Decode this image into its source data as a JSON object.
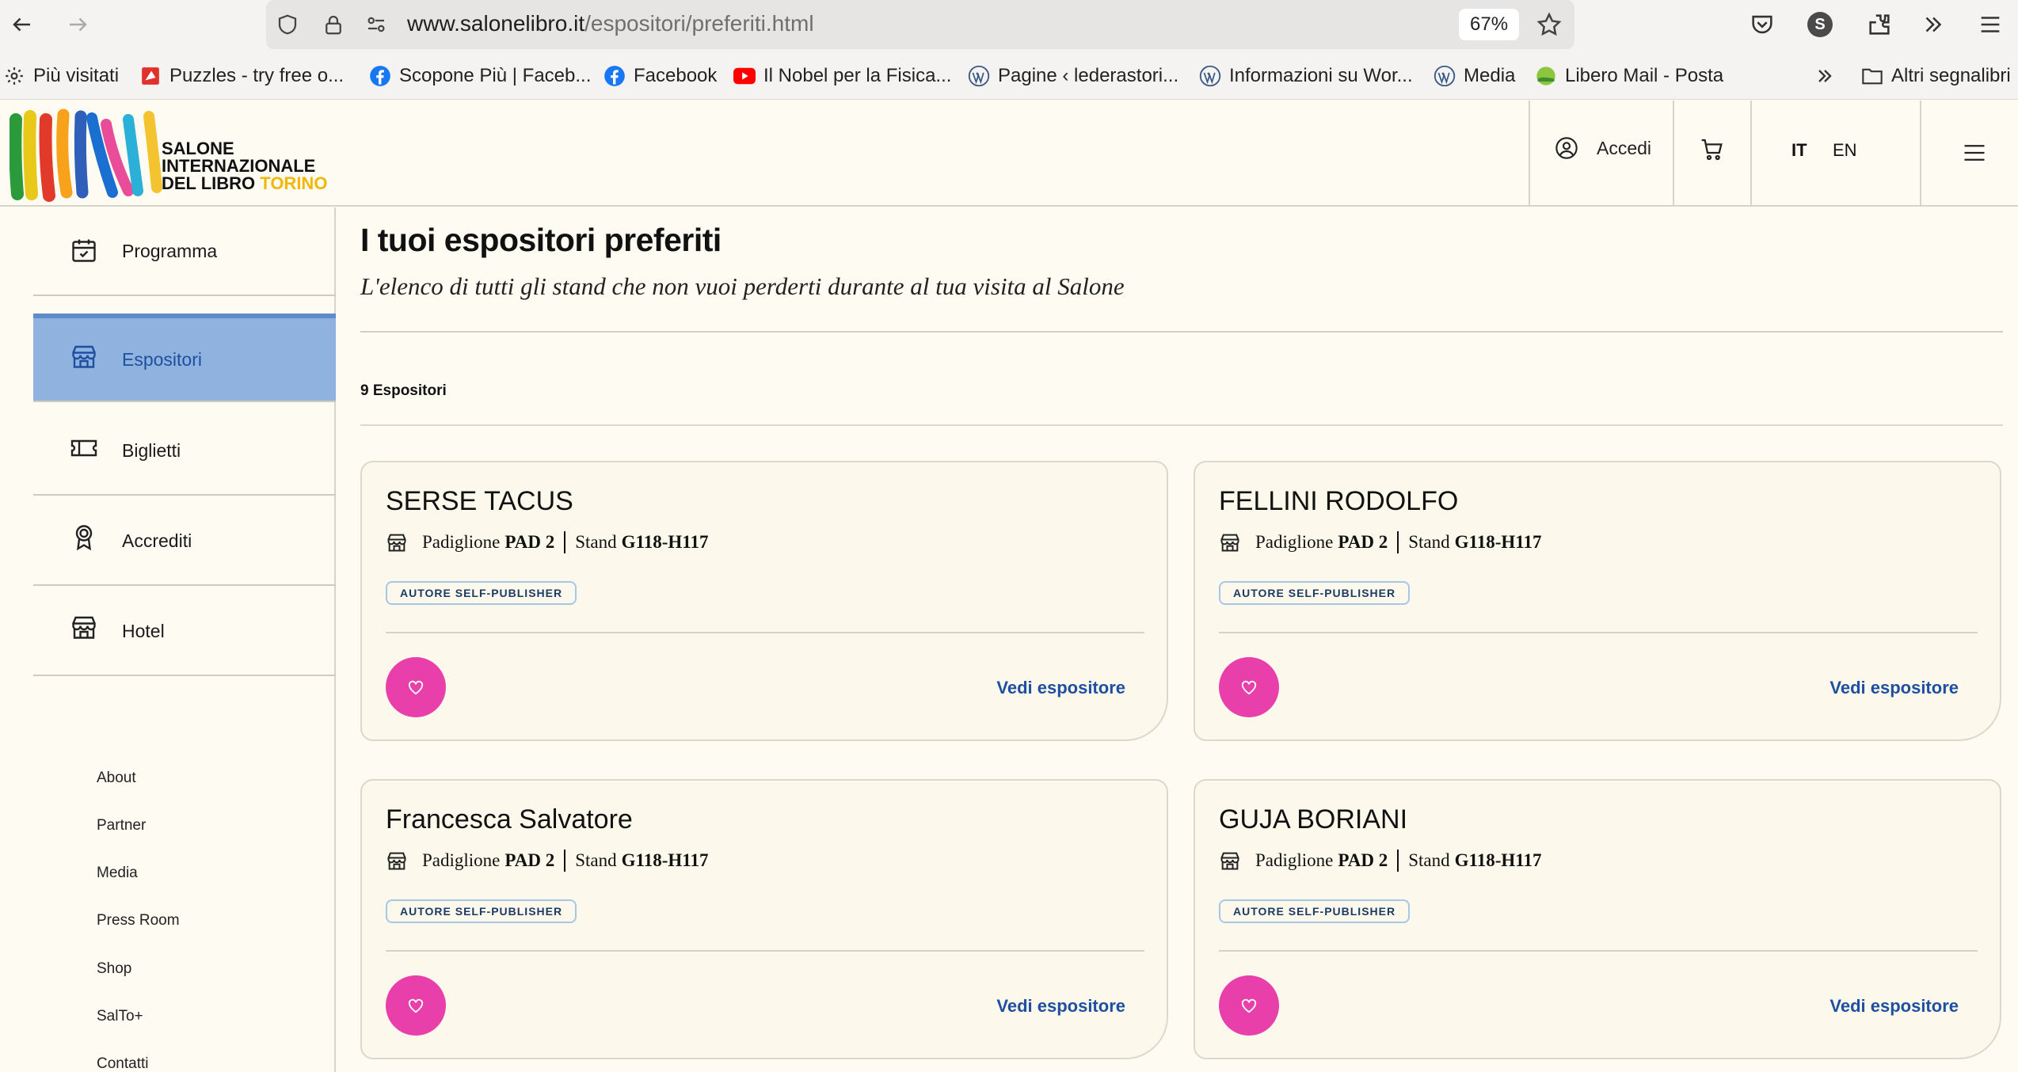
{
  "browser": {
    "url_host": "www.salonelibro.it",
    "url_path": "/espositori/preferiti.html",
    "zoom": "67%",
    "profile_initial": "S",
    "bookmarks": [
      {
        "label": "Più visitati",
        "icon": "gear-icon"
      },
      {
        "label": "Puzzles - try free o...",
        "icon": "puzzle-icon"
      },
      {
        "label": "Scopone Più | Faceb...",
        "icon": "facebook-icon"
      },
      {
        "label": "Facebook",
        "icon": "facebook-icon"
      },
      {
        "label": "Il Nobel per la Fisica...",
        "icon": "youtube-icon"
      },
      {
        "label": "Pagine ‹ lederastori...",
        "icon": "wordpress-icon"
      },
      {
        "label": "Informazioni su Wor...",
        "icon": "wordpress-icon"
      },
      {
        "label": "Media",
        "icon": "wordpress-icon"
      },
      {
        "label": "Libero Mail - Posta",
        "icon": "libero-icon"
      }
    ],
    "other_bookmarks": "Altri segnalibri"
  },
  "header": {
    "logo_lines": [
      "SALONE",
      "INTERNAZIONALE",
      "DEL LIBRO"
    ],
    "logo_city": "TORINO",
    "login": "Accedi",
    "lang_it": "IT",
    "lang_en": "EN"
  },
  "sidebar": {
    "items": [
      {
        "label": "Programma",
        "icon": "calendar-check-icon",
        "active": false
      },
      {
        "label": "Espositori",
        "icon": "store-icon",
        "active": true
      },
      {
        "label": "Biglietti",
        "icon": "ticket-icon",
        "active": false
      },
      {
        "label": "Accrediti",
        "icon": "badge-icon",
        "active": false
      },
      {
        "label": "Hotel",
        "icon": "store-icon",
        "active": false
      }
    ],
    "footer_links": [
      "About",
      "Partner",
      "Media",
      "Press Room",
      "Shop",
      "SalTo+",
      "Contatti"
    ]
  },
  "main": {
    "title": "I tuoi espositori preferiti",
    "subtitle": "L'elenco di tutti gli stand che non vuoi perderti durante al tua visita al Salone",
    "count": "9 Espositori",
    "cards": [
      {
        "name": "SERSE TACUS",
        "pav_label": "Padiglione",
        "pav": "PAD 2",
        "stand_label": "Stand",
        "stand": "G118-H117",
        "tag": "AUTORE SELF-PUBLISHER",
        "link": "Vedi espositore"
      },
      {
        "name": "FELLINI RODOLFO",
        "pav_label": "Padiglione",
        "pav": "PAD 2",
        "stand_label": "Stand",
        "stand": "G118-H117",
        "tag": "AUTORE SELF-PUBLISHER",
        "link": "Vedi espositore"
      },
      {
        "name": "Francesca Salvatore",
        "pav_label": "Padiglione",
        "pav": "PAD 2",
        "stand_label": "Stand",
        "stand": "G118-H117",
        "tag": "AUTORE SELF-PUBLISHER",
        "link": "Vedi espositore"
      },
      {
        "name": "GUJA BORIANI",
        "pav_label": "Padiglione",
        "pav": "PAD 2",
        "stand_label": "Stand",
        "stand": "G118-H117",
        "tag": "AUTORE SELF-PUBLISHER",
        "link": "Vedi espositore"
      }
    ]
  },
  "colors": {
    "accent_blue": "#1f4fa0",
    "active_bg": "#8fb3de",
    "favorite_pink": "#e83faa",
    "page_bg": "#fdfbf2"
  }
}
